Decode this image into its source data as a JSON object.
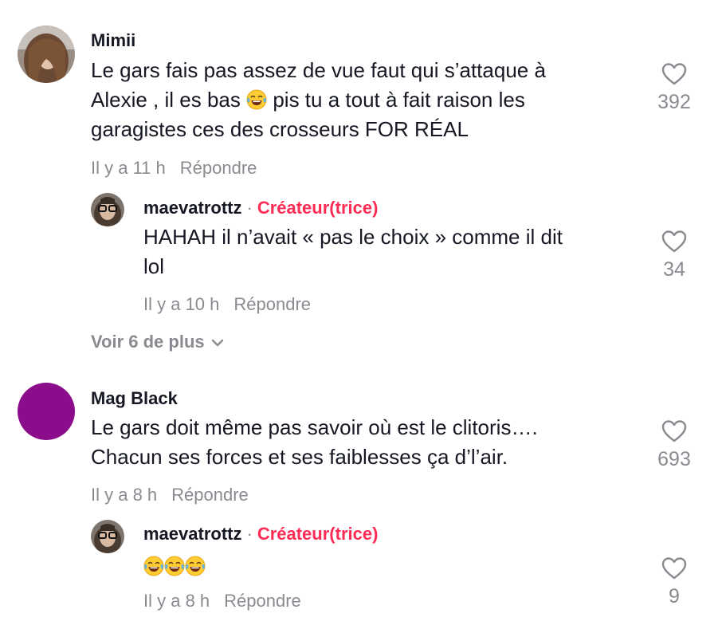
{
  "comments": [
    {
      "username": "Mimii",
      "text_lines": [
        "Le gars fais pas assez de vue faut qui s’attaque à",
        "Alexie , il es bas",
        "pis tu a tout à fait raison les",
        "garagistes ces des crosseurs FOR RÉAL"
      ],
      "time": "Il y a 11 h",
      "reply_label": "Répondre",
      "likes": "392",
      "reply": {
        "username": "maevatrottz",
        "separator": "·",
        "badge": "Créateur(trice)",
        "text_lines": [
          "HAHAH il n’avait « pas le choix » comme il dit",
          "lol"
        ],
        "time": "Il y a 10 h",
        "reply_label": "Répondre",
        "likes": "34"
      },
      "more_label": "Voir 6 de plus"
    },
    {
      "username": "Mag Black",
      "text_lines": [
        "Le gars doit même pas savoir où est le clitoris….",
        "Chacun ses forces et ses faiblesses ça d’l’air."
      ],
      "time": "Il y a 8 h",
      "reply_label": "Répondre",
      "likes": "693",
      "avatar_color": "#8b0d8b",
      "reply": {
        "username": "maevatrottz",
        "separator": "·",
        "badge": "Créateur(trice)",
        "time": "Il y a 8 h",
        "reply_label": "Répondre",
        "likes": "9"
      }
    }
  ],
  "icons": {
    "like": "heart-outline-icon",
    "expand": "chevron-down-icon",
    "emoji": "face-with-tears-of-joy-emoji"
  },
  "colors": {
    "creator_badge": "#fe2c55",
    "meta_text": "#8a8b91",
    "primary_text": "#161823"
  }
}
